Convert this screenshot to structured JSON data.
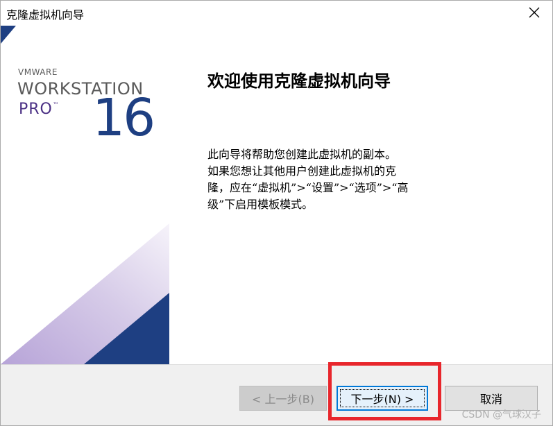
{
  "window": {
    "title": "克隆虚拟机向导"
  },
  "banner": {
    "vendor": "VMWARE",
    "product": "WORKSTATION",
    "edition": "PRO",
    "trademark": "™",
    "version": "16",
    "colors": {
      "navy": "#1e3f82",
      "purple": "#4a2f84",
      "lavender": "#b8a8d6"
    }
  },
  "content": {
    "heading": "欢迎使用克隆虚拟机向导",
    "body_lines": [
      "此向导将帮助您创建此虚拟机的副本。",
      "如果您想让其他用户创建此虚拟机的克",
      "隆，应在“虚拟机”>“设置”>“选项”>“高",
      "级”下启用模板模式。"
    ]
  },
  "buttons": {
    "back": "< 上一步(B)",
    "next": "下一步(N) >",
    "cancel": "取消"
  },
  "annotation": {
    "highlight_color": "#e8262c"
  },
  "watermark": "CSDN @气球汉子"
}
